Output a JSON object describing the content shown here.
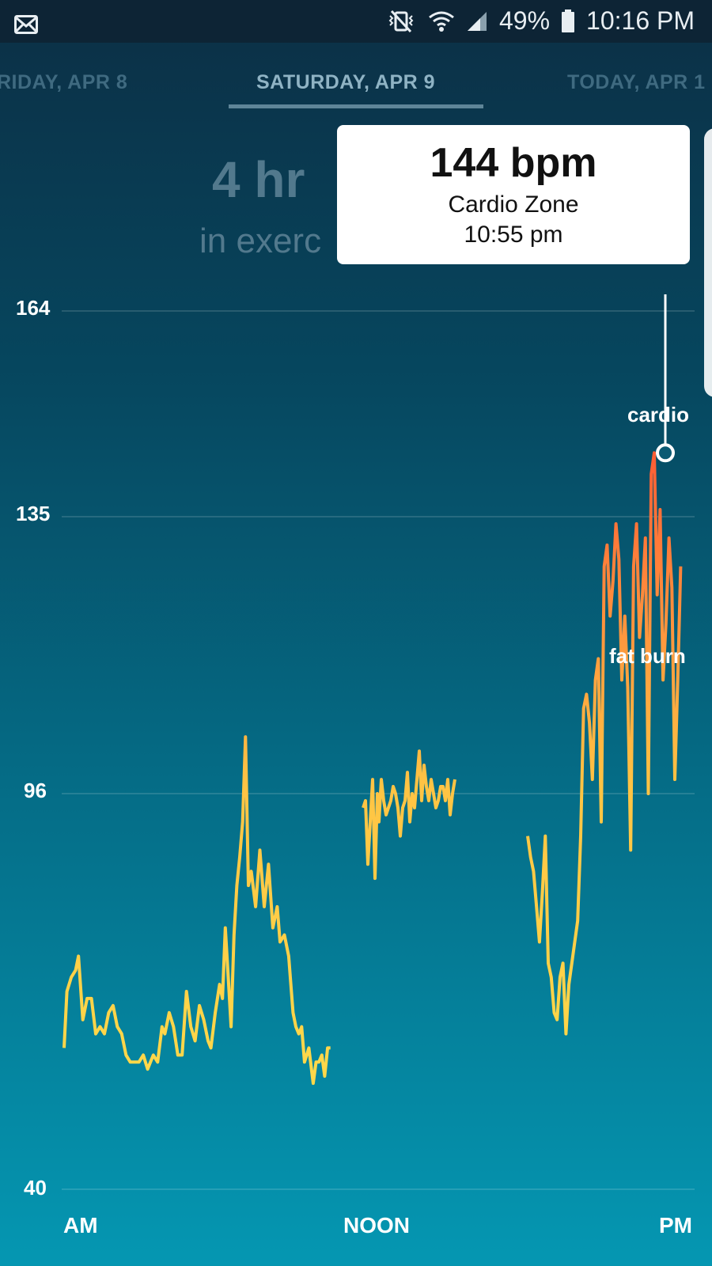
{
  "status_bar": {
    "left_icon": "mail-icon",
    "icons": [
      "vibrate-mute-icon",
      "wifi-icon",
      "signal-icon",
      "battery-icon"
    ],
    "battery": "49%",
    "time": "10:16 PM"
  },
  "date_tabs": {
    "prev": "RIDAY, APR 8",
    "current": "SATURDAY, APR 9",
    "next": "TODAY, APR 1"
  },
  "summary": {
    "big": "4 hr",
    "small": "in exerc"
  },
  "tooltip": {
    "bpm": "144 bpm",
    "zone": "Cardio Zone",
    "time": "10:55 pm"
  },
  "chart_data": {
    "type": "line",
    "ylim": [
      40,
      164
    ],
    "y_ticks": [
      "164",
      "135",
      "96",
      "40"
    ],
    "x_ticks": [
      "AM",
      "NOON",
      "PM"
    ],
    "zone_labels": [
      "cardio",
      "fat burn"
    ],
    "highlight": {
      "value": 144,
      "label": "Cardio Zone",
      "time": "10:55 pm"
    },
    "series": [
      {
        "values": [
          [
            0,
            60
          ],
          [
            0.2,
            68
          ],
          [
            0.5,
            70
          ],
          [
            0.8,
            71
          ],
          [
            1.0,
            73
          ],
          [
            1.3,
            64
          ],
          [
            1.6,
            67
          ],
          [
            1.9,
            67
          ],
          [
            2.2,
            62
          ],
          [
            2.5,
            63
          ],
          [
            2.8,
            62
          ],
          [
            3.1,
            65
          ],
          [
            3.4,
            66
          ],
          [
            3.7,
            63
          ],
          [
            4.0,
            62
          ],
          [
            4.3,
            59
          ],
          [
            4.6,
            58
          ],
          [
            4.9,
            58
          ],
          [
            5.2,
            58
          ],
          [
            5.5,
            59
          ],
          [
            5.8,
            57
          ],
          [
            6.0,
            58
          ],
          [
            6.2,
            59
          ],
          [
            6.5,
            58
          ],
          [
            6.8,
            63
          ],
          [
            7.0,
            62
          ],
          [
            7.3,
            65
          ],
          [
            7.6,
            63
          ],
          [
            7.9,
            59
          ],
          [
            8.2,
            59
          ],
          [
            8.5,
            68
          ],
          [
            8.8,
            63
          ],
          [
            9.1,
            61
          ],
          [
            9.4,
            66
          ],
          [
            9.7,
            64
          ],
          [
            10.0,
            61
          ],
          [
            10.2,
            60
          ],
          [
            10.5,
            65
          ],
          [
            10.8,
            69
          ],
          [
            11.0,
            67
          ],
          [
            11.2,
            77
          ],
          [
            11.4,
            70
          ],
          [
            11.6,
            63
          ],
          [
            11.8,
            76
          ],
          [
            12.0,
            83
          ],
          [
            12.2,
            87
          ],
          [
            12.4,
            92
          ],
          [
            12.6,
            104
          ],
          [
            12.8,
            83
          ],
          [
            13.0,
            85
          ],
          [
            13.3,
            80
          ],
          [
            13.6,
            88
          ],
          [
            13.9,
            80
          ],
          [
            14.2,
            86
          ],
          [
            14.5,
            77
          ],
          [
            14.8,
            80
          ],
          [
            15.0,
            75
          ],
          [
            15.3,
            76
          ],
          [
            15.6,
            73
          ],
          [
            15.9,
            65
          ],
          [
            16.1,
            63
          ],
          [
            16.3,
            62
          ],
          [
            16.5,
            63
          ],
          [
            16.7,
            58
          ],
          [
            17.0,
            60
          ],
          [
            17.3,
            55
          ],
          [
            17.5,
            58
          ],
          [
            17.7,
            58
          ],
          [
            17.9,
            59
          ],
          [
            18.1,
            56
          ],
          [
            18.3,
            60
          ],
          [
            18.5,
            60
          ]
        ]
      },
      {
        "values": [
          [
            0,
            94
          ],
          [
            0.3,
            95
          ],
          [
            0.6,
            86
          ],
          [
            0.9,
            92
          ],
          [
            1.2,
            98
          ],
          [
            1.5,
            84
          ],
          [
            1.8,
            96
          ],
          [
            2.0,
            92
          ],
          [
            2.3,
            98
          ],
          [
            2.6,
            95
          ],
          [
            2.9,
            93
          ],
          [
            3.2,
            94
          ],
          [
            3.5,
            95
          ],
          [
            3.8,
            97
          ],
          [
            4.1,
            96
          ],
          [
            4.4,
            94
          ],
          [
            4.7,
            90
          ],
          [
            5.0,
            94
          ],
          [
            5.3,
            95
          ],
          [
            5.6,
            99
          ],
          [
            5.9,
            92
          ],
          [
            6.2,
            96
          ],
          [
            6.5,
            94
          ],
          [
            6.8,
            98
          ],
          [
            7.1,
            102
          ],
          [
            7.4,
            95
          ],
          [
            7.7,
            100
          ],
          [
            8.0,
            97
          ],
          [
            8.3,
            95
          ],
          [
            8.6,
            98
          ],
          [
            8.9,
            96
          ],
          [
            9.2,
            94
          ],
          [
            9.5,
            95
          ],
          [
            9.8,
            97
          ],
          [
            10.1,
            97
          ],
          [
            10.4,
            95
          ],
          [
            10.7,
            98
          ],
          [
            11.0,
            93
          ],
          [
            11.3,
            96
          ],
          [
            11.6,
            98
          ]
        ]
      },
      {
        "values": [
          [
            0,
            90
          ],
          [
            0.3,
            87
          ],
          [
            0.6,
            85
          ],
          [
            0.9,
            80
          ],
          [
            1.2,
            75
          ],
          [
            1.5,
            82
          ],
          [
            1.8,
            90
          ],
          [
            2.1,
            72
          ],
          [
            2.4,
            70
          ],
          [
            2.7,
            65
          ],
          [
            3.0,
            64
          ],
          [
            3.3,
            70
          ],
          [
            3.6,
            72
          ],
          [
            3.9,
            62
          ],
          [
            4.2,
            69
          ],
          [
            4.5,
            72
          ],
          [
            4.8,
            75
          ],
          [
            5.1,
            78
          ],
          [
            5.4,
            90
          ],
          [
            5.7,
            108
          ],
          [
            6.0,
            110
          ],
          [
            6.3,
            106
          ],
          [
            6.6,
            98
          ],
          [
            6.9,
            112
          ],
          [
            7.2,
            115
          ],
          [
            7.5,
            92
          ],
          [
            7.8,
            128
          ],
          [
            8.1,
            131
          ],
          [
            8.4,
            121
          ],
          [
            8.7,
            126
          ],
          [
            9.0,
            134
          ],
          [
            9.3,
            129
          ],
          [
            9.6,
            112
          ],
          [
            9.9,
            121
          ],
          [
            10.2,
            111
          ],
          [
            10.5,
            88
          ],
          [
            10.8,
            128
          ],
          [
            11.1,
            134
          ],
          [
            11.4,
            118
          ],
          [
            11.7,
            124
          ],
          [
            12.0,
            132
          ],
          [
            12.3,
            96
          ],
          [
            12.6,
            141
          ],
          [
            12.9,
            144
          ],
          [
            13.2,
            124
          ],
          [
            13.5,
            136
          ],
          [
            13.8,
            112
          ],
          [
            14.1,
            120
          ],
          [
            14.4,
            132
          ],
          [
            14.7,
            125
          ],
          [
            15.0,
            98
          ],
          [
            15.3,
            112
          ],
          [
            15.6,
            128
          ]
        ]
      }
    ]
  }
}
